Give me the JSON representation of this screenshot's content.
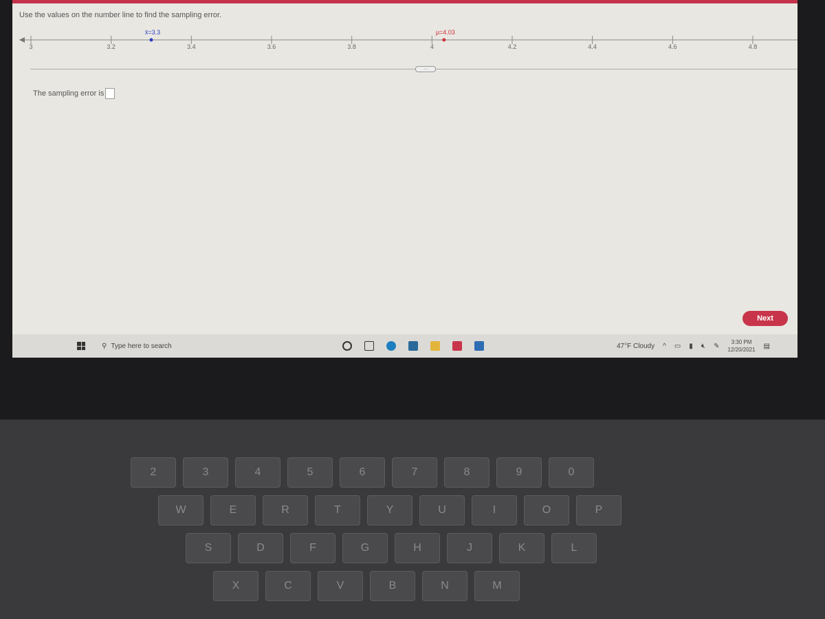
{
  "question": {
    "instruction": "Use the values on the number line to find the sampling error.",
    "answer_prompt": "The sampling error is",
    "answer_value": "",
    "next_label": "Next",
    "more_label": "..."
  },
  "number_line": {
    "ticks": [
      "3",
      "3.2",
      "3.4",
      "3.6",
      "3.8",
      "4",
      "4.2",
      "4.4",
      "4.6",
      "4.8"
    ],
    "range": [
      3,
      4.8
    ],
    "points": [
      {
        "label": "x̄=3.3",
        "value": 3.3,
        "color": "#2a3fbf"
      },
      {
        "label": "μ=4.03",
        "value": 4.03,
        "color": "#d0303a"
      }
    ]
  },
  "taskbar": {
    "search_placeholder": "Type here to search",
    "weather": "47°F  Cloudy",
    "time": "3:30 PM",
    "date": "12/20/2021"
  },
  "keyboard": {
    "rows": [
      [
        "2",
        "3",
        "4",
        "5",
        "6",
        "7",
        "8",
        "9",
        "0"
      ],
      [
        "W",
        "E",
        "R",
        "T",
        "Y",
        "U",
        "I",
        "O",
        "P"
      ],
      [
        "S",
        "D",
        "F",
        "G",
        "H",
        "J",
        "K",
        "L"
      ],
      [
        "X",
        "C",
        "V",
        "B",
        "N",
        "M"
      ]
    ]
  },
  "colors": {
    "accent": "#c8354a"
  }
}
